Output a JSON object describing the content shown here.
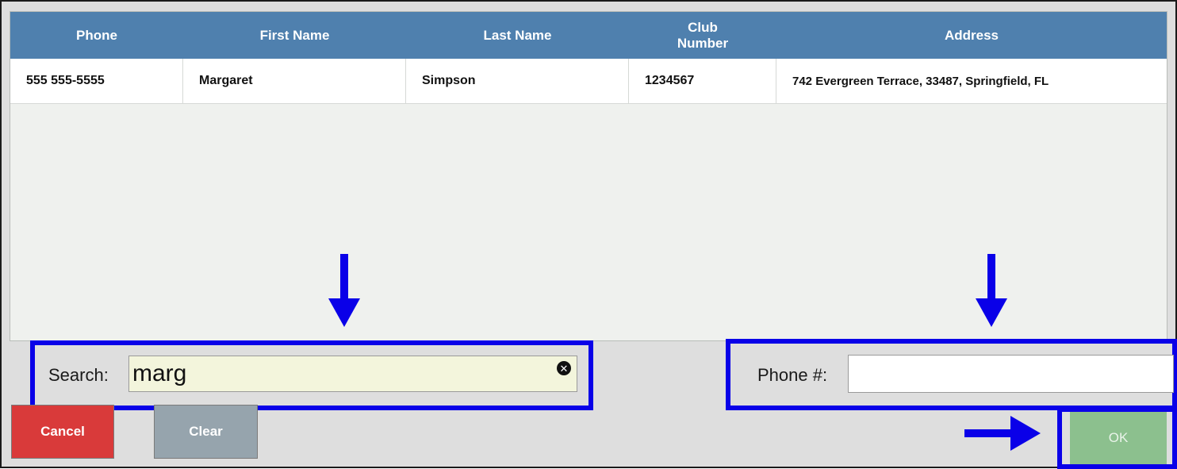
{
  "table": {
    "columns": [
      "Phone",
      "First Name",
      "Last Name",
      "Club\nNumber",
      "Address"
    ],
    "rows": [
      {
        "phone": "555 555-5555",
        "first_name": "Margaret",
        "last_name": "Simpson",
        "club_number": "1234567",
        "address": "742 Evergreen Terrace, 33487, Springfield, FL"
      }
    ]
  },
  "search": {
    "label": "Search:",
    "value": "marg",
    "clear_icon": "circle-x-icon"
  },
  "phone": {
    "label": "Phone #:",
    "value": ""
  },
  "buttons": {
    "cancel": "Cancel",
    "clear": "Clear",
    "ok": "OK"
  },
  "colors": {
    "header": "#4f80ae",
    "cancel": "#d93a3a",
    "clear": "#96a4ad",
    "ok": "#8cc08e",
    "highlight": "#0a00e8"
  }
}
